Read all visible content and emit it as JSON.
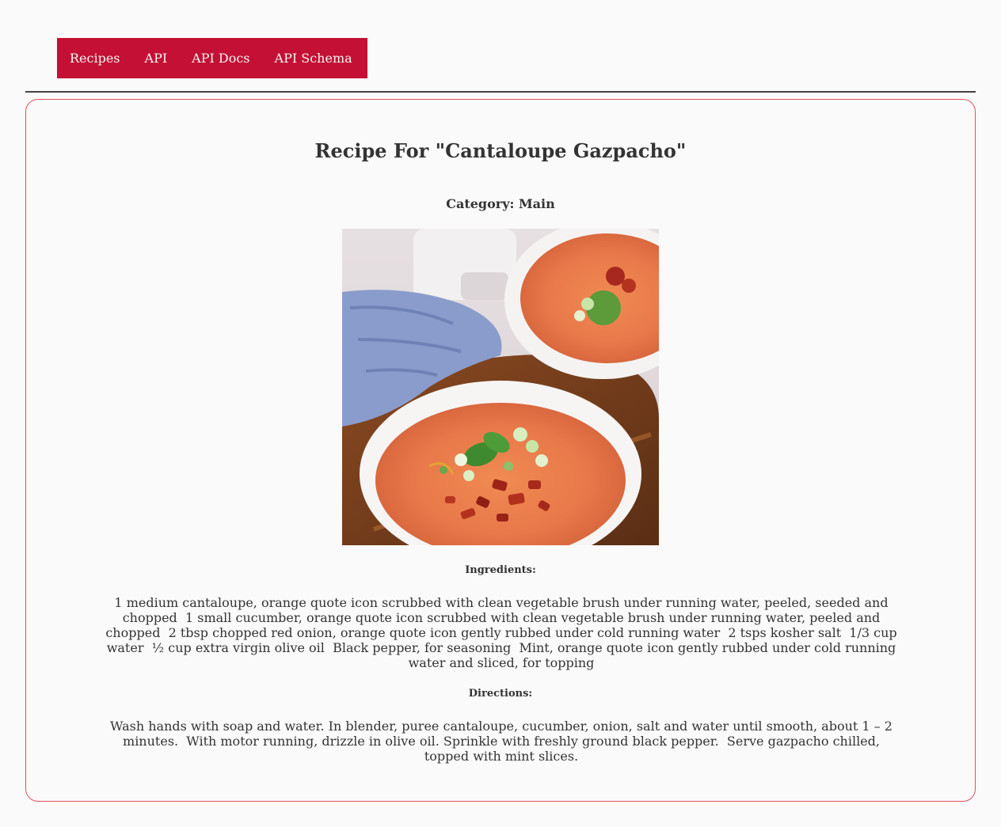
{
  "nav": {
    "items": [
      {
        "label": "Recipes"
      },
      {
        "label": "API"
      },
      {
        "label": "API Docs"
      },
      {
        "label": "API Schema"
      }
    ]
  },
  "recipe": {
    "title": "Recipe For \"Cantaloupe Gazpacho\"",
    "category": "Category: Main",
    "image_alt": "Cantaloupe Gazpacho",
    "ingredients_label": "Ingredients:",
    "ingredients": "1 medium cantaloupe, orange quote icon scrubbed with clean vegetable brush under running water, peeled, seeded and chopped  1 small cucumber, orange quote icon scrubbed with clean vegetable brush under running water, peeled and chopped  2 tbsp chopped red onion, orange quote icon gently rubbed under cold running water  2 tsps kosher salt  1/3 cup water  ½ cup extra virgin olive oil  Black pepper, for seasoning  Mint, orange quote icon gently rubbed under cold running water and sliced, for topping",
    "directions_label": "Directions:",
    "directions": "Wash hands with soap and water. In blender, puree cantaloupe, cucumber, onion, salt and water until smooth, about 1 – 2 minutes.  With motor running, drizzle in olive oil. Sprinkle with freshly ground black pepper.  Serve gazpacho chilled, topped with mint slices."
  },
  "colors": {
    "nav_bg": "#c41034",
    "nav_text": "#f4f4f4",
    "card_border": "#e0525c",
    "divider": "#4a4048",
    "text": "#333333"
  }
}
